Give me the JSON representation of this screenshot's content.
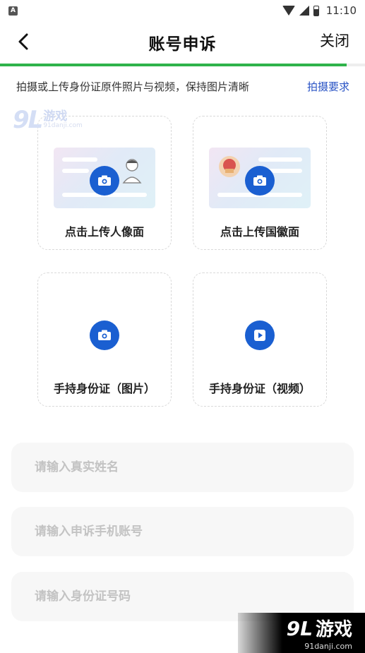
{
  "status_bar": {
    "left_icon": "A",
    "time": "11:10",
    "icons": [
      "wifi-icon",
      "signal-icon",
      "battery-icon"
    ]
  },
  "nav": {
    "title": "账号申诉",
    "close_label": "关闭",
    "back_icon": "chevron-left-icon"
  },
  "progress": {
    "fraction": 0.95,
    "color": "#2fb34a"
  },
  "instruction": {
    "text": "拍摄或上传身份证原件照片与视频，保持图片清晰",
    "link_label": "拍摄要求"
  },
  "upload_cards": [
    {
      "label": "点击上传人像面",
      "icon": "camera-icon",
      "illustration": "id-portrait"
    },
    {
      "label": "点击上传国徽面",
      "icon": "camera-icon",
      "illustration": "id-emblem"
    },
    {
      "label": "手持身份证（图片）",
      "icon": "camera-icon",
      "illustration": "none"
    },
    {
      "label": "手持身份证（视频）",
      "icon": "video-play-icon",
      "illustration": "none"
    }
  ],
  "form": {
    "name_placeholder": "请输入真实姓名",
    "phone_placeholder": "请输入申诉手机账号",
    "id_placeholder": "请输入身份证号码"
  },
  "watermark": {
    "logo_mark": "9L",
    "name": "游戏",
    "url": "91danji.com"
  },
  "colors": {
    "accent": "#1a5fd1",
    "link": "#2a54c5",
    "progress": "#2fb34a"
  }
}
